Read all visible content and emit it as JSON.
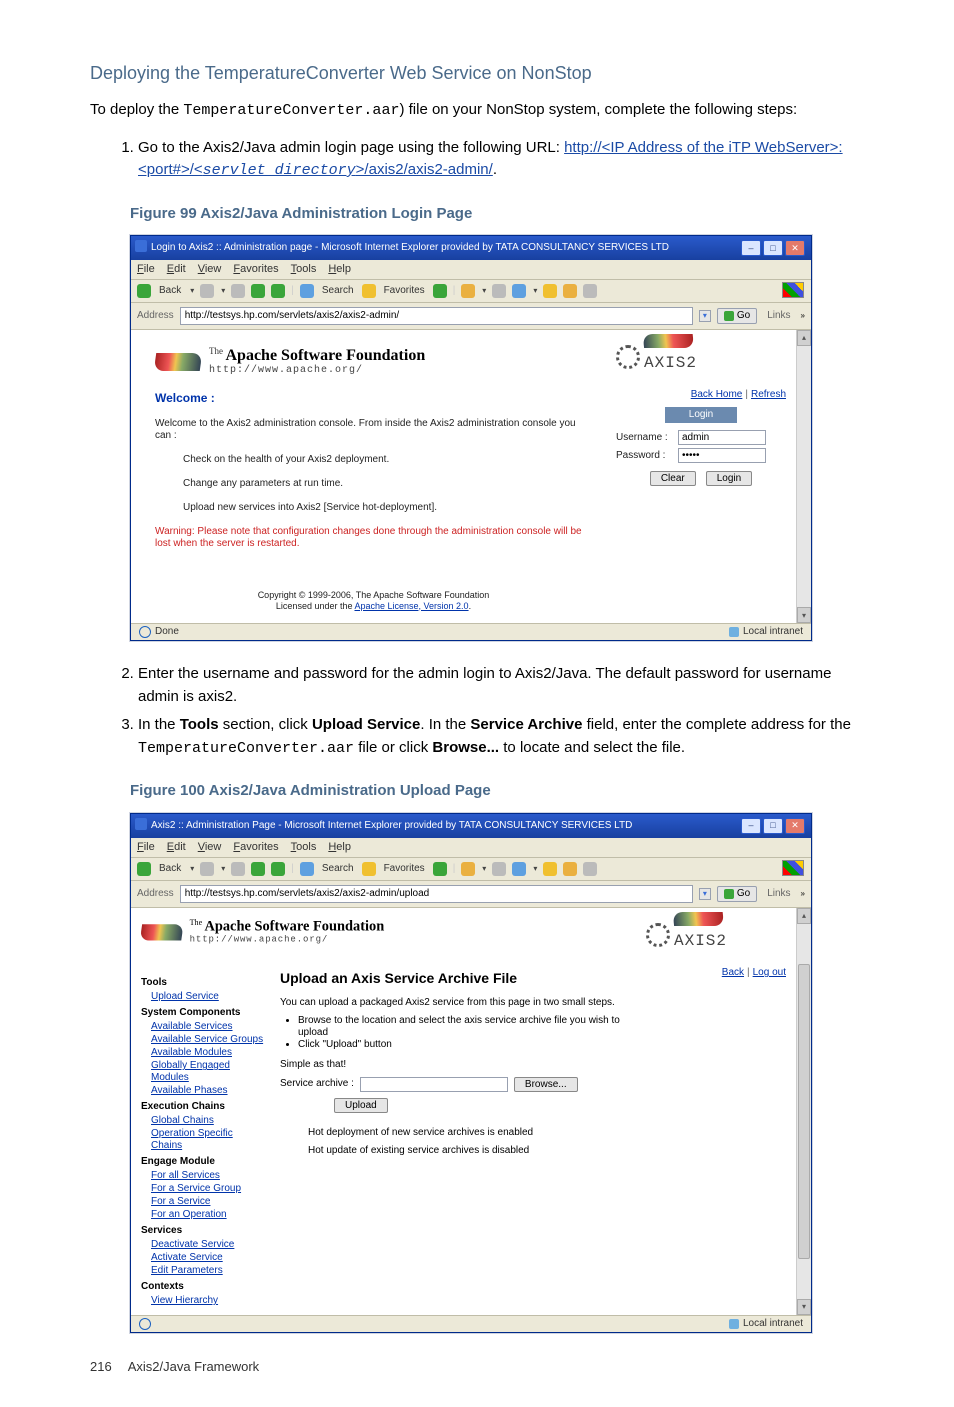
{
  "section_heading": "Deploying the TemperatureConverter Web Service on NonStop",
  "intro_prefix": "To deploy the ",
  "intro_code": "TemperatureConverter.aar",
  "intro_suffix": ") file on your NonStop system, complete the following steps:",
  "step1_prefix": "Go to the Axis2/Java admin login page using the following URL: ",
  "step1_link_text_a": "http://<IP Address of the iTP WebServer>:<port#>/<",
  "step1_link_italic": "servlet_directory",
  "step1_link_text_b": ">/axis2/axis2-admin/",
  "step1_trailing": ".",
  "figure99_caption": "Figure 99 Axis2/Java Administration Login Page",
  "fig99": {
    "title": "Login to Axis2 :: Administration page - Microsoft Internet Explorer provided by TATA CONSULTANCY SERVICES LTD",
    "menubar": [
      "File",
      "Edit",
      "View",
      "Favorites",
      "Tools",
      "Help"
    ],
    "toolbar": {
      "back": "Back",
      "search": "Search",
      "favorites": "Favorites"
    },
    "address_label": "Address",
    "address_value": "http://testsys.hp.com/servlets/axis2/axis2-admin/",
    "go_label": "Go",
    "links_label": "Links",
    "apache_the": "The",
    "apache_main": "Apache Software Foundation",
    "apache_sub": "http://www.apache.org/",
    "axis_text": "AXIS2",
    "side_back_home": "Back Home",
    "side_refresh": "Refresh",
    "login_tab": "Login",
    "username_label": "Username :",
    "username_value": "admin",
    "password_label": "Password :",
    "password_value": "•••••",
    "btn_clear": "Clear",
    "btn_login": "Login",
    "welcome_head": "Welcome :",
    "welcome_intro": "Welcome to the Axis2 administration console. From inside the Axis2 administration console you can :",
    "welcome_point1": "Check on the health of your Axis2 deployment.",
    "welcome_point2": "Change any parameters at run time.",
    "welcome_point3": "Upload new services into Axis2 [Service hot-deployment].",
    "warning": "Warning: Please note that configuration changes done through the administration console will be lost when the server is restarted.",
    "copyright_line1": "Copyright © 1999-2006, The Apache Software Foundation",
    "copyright_line2a": "Licensed under the ",
    "copyright_link": "Apache License, Version 2.0",
    "copyright_line2b": ".",
    "status_done": "Done",
    "status_zone": "Local intranet"
  },
  "step2_text": "Enter the username and password for the admin login to Axis2/Java. The default password for username admin is axis2.",
  "step3_a": "In the ",
  "step3_b": "Tools",
  "step3_c": " section, click ",
  "step3_d": "Upload Service",
  "step3_e": ". In the ",
  "step3_f": "Service Archive",
  "step3_g": " field, enter the complete address for the ",
  "step3_code": "TemperatureConverter.aar",
  "step3_h": " file or click ",
  "step3_i": "Browse...",
  "step3_j": " to locate and select the file.",
  "figure100_caption": "Figure 100 Axis2/Java Administration Upload Page",
  "fig100": {
    "title": "Axis2 :: Administration Page - Microsoft Internet Explorer provided by TATA CONSULTANCY SERVICES LTD",
    "menubar": [
      "File",
      "Edit",
      "View",
      "Favorites",
      "Tools",
      "Help"
    ],
    "toolbar": {
      "back": "Back",
      "search": "Search",
      "favorites": "Favorites"
    },
    "address_label": "Address",
    "address_value": "http://testsys.hp.com/servlets/axis2/axis2-admin/upload",
    "go_label": "Go",
    "links_label": "Links",
    "apache_the": "The",
    "apache_main": "Apache Software Foundation",
    "apache_sub": "http://www.apache.org/",
    "axis_text": "AXIS2",
    "side_back": "Back",
    "side_logout": "Log out",
    "nav": {
      "tools_head": "Tools",
      "tools": [
        "Upload Service"
      ],
      "sys_head": "System Components",
      "sys": [
        "Available Services",
        "Available Service Groups",
        "Available Modules",
        "Globally Engaged Modules",
        "Available Phases"
      ],
      "exec_head": "Execution Chains",
      "exec": [
        "Global Chains",
        "Operation Specific Chains"
      ],
      "eng_head": "Engage Module",
      "eng": [
        "For all Services",
        "For a Service Group",
        "For a Service",
        "For an Operation"
      ],
      "svc_head": "Services",
      "svc": [
        "Deactivate Service",
        "Activate Service",
        "Edit Parameters"
      ],
      "ctx_head": "Contexts",
      "ctx": [
        "View Hierarchy"
      ]
    },
    "upload_head": "Upload an Axis Service Archive File",
    "upload_p1": "You can upload a packaged Axis2 service from this page in two small steps.",
    "upload_li1": "Browse to the location and select the axis service archive file you wish to upload",
    "upload_li2": "Click \"Upload\" button",
    "upload_simple": "Simple as that!",
    "sa_label": "Service archive :",
    "browse_btn": "Browse...",
    "upload_btn": "Upload",
    "hot1": "Hot deployment of new service archives is enabled",
    "hot2": "Hot update of existing service archives is disabled",
    "status_zone": "Local intranet"
  },
  "footer_page": "216",
  "footer_text": "Axis2/Java Framework"
}
